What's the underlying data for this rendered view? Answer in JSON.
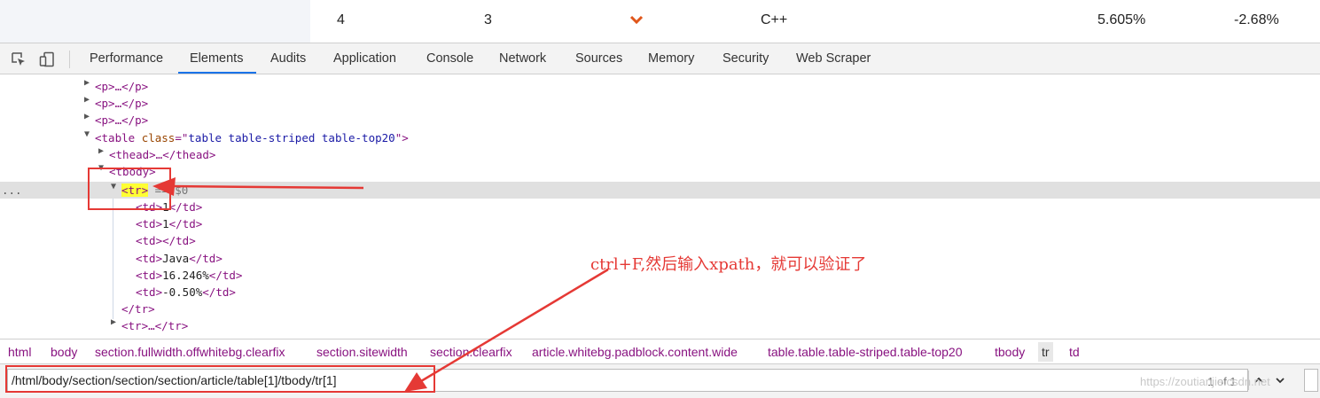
{
  "page_row": {
    "cells": [
      "4",
      "3",
      "C++",
      "5.605%",
      "-2.68%"
    ],
    "change_icon": "chevron-down-icon"
  },
  "toolbar": {
    "inspect_icon": "inspect-element-icon",
    "device_icon": "device-toolbar-icon",
    "tabs": [
      "Performance",
      "Elements",
      "Audits",
      "Application",
      "Console",
      "Network",
      "Sources",
      "Memory",
      "Security",
      "Web Scraper"
    ],
    "active_tab": "Elements"
  },
  "dom_tree": {
    "p_tag": "<p>…</p>",
    "table_open": "<table ",
    "table_class_attr": "class",
    "table_class_eq": "=\"",
    "table_class_value": "table table-striped table-top20",
    "table_class_end": "\">",
    "thead": "<thead>…</thead>",
    "tbody": "<tbody>",
    "tr_selected": "<tr>",
    "tr_selected_suffix": " == $0",
    "td_rows": [
      {
        "open": "<td>",
        "text": "1",
        "close": "</td>"
      },
      {
        "open": "<td>",
        "text": "1",
        "close": "</td>"
      },
      {
        "open": "<td>",
        "text": "",
        "close": "</td>"
      },
      {
        "open": "<td>",
        "text": "Java",
        "close": "</td>"
      },
      {
        "open": "<td>",
        "text": "16.246%",
        "close": "</td>"
      },
      {
        "open": "<td>",
        "text": "-0.50%",
        "close": "</td>"
      }
    ],
    "tr_close": "</tr>",
    "tr_collapsed": "<tr>…</tr>",
    "more_dots": "..."
  },
  "breadcrumbs": [
    "html",
    "body",
    "section.fullwidth.offwhitebg.clearfix",
    "section.sitewidth",
    "section.clearfix",
    "article.whitebg.padblock.content.wide",
    "table.table.table-striped.table-top20",
    "tbody",
    "tr",
    "td"
  ],
  "selected_crumb": "tr",
  "search": {
    "value": "/html/body/section/section/section/article/table[1]/tbody/tr[1]",
    "match_count": "1 of 1",
    "prev_label": "⌃",
    "next_label": "⌄"
  },
  "annotation": {
    "text": "ctrl+F,然后输入xpath，就可以验证了",
    "color": "#e53935"
  },
  "watermark": "https://zoutianjie.csdn.net",
  "colors": {
    "tag": "#881280",
    "attr": "#994500",
    "value": "#1a1aa6",
    "highlight": "#ffff33",
    "selected_row": "#e0e0e0",
    "active_tab_underline": "#1a73e8",
    "annotation_red": "#e53935"
  }
}
